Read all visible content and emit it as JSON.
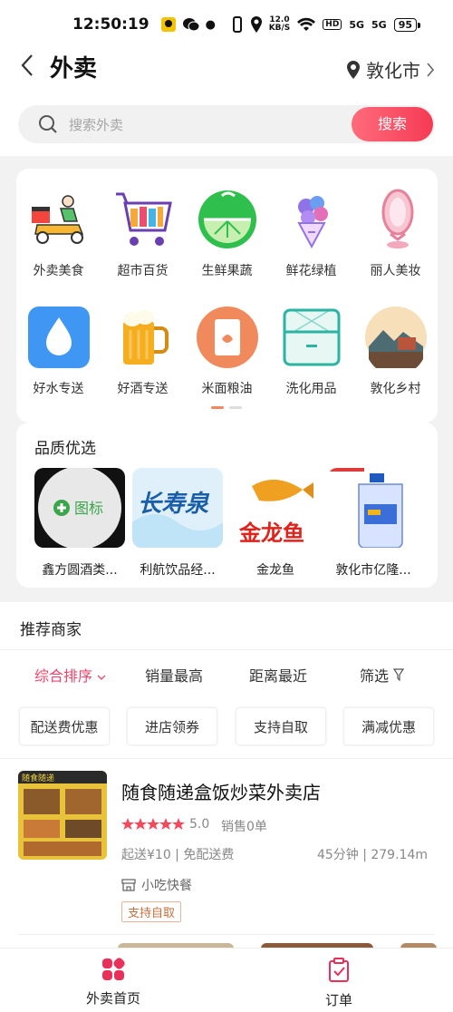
{
  "status_bar": {
    "time": "12:50:19",
    "net_speed": "12.0",
    "net_unit": "KB/S",
    "hd": "HD",
    "sig1": "5G",
    "sig2": "5G",
    "battery": "95"
  },
  "header": {
    "title": "外卖",
    "city": "敦化市"
  },
  "search": {
    "placeholder": "搜索外卖",
    "button": "搜索"
  },
  "categories": [
    {
      "label": "外卖美食",
      "icon": "delivery-scooter-icon"
    },
    {
      "label": "超市百货",
      "icon": "shopping-cart-icon"
    },
    {
      "label": "生鲜果蔬",
      "icon": "lime-icon"
    },
    {
      "label": "鲜花绿植",
      "icon": "flower-bouquet-icon"
    },
    {
      "label": "丽人美妆",
      "icon": "mirror-icon"
    },
    {
      "label": "好水专送",
      "icon": "water-drop-icon"
    },
    {
      "label": "好酒专送",
      "icon": "beer-icon"
    },
    {
      "label": "米面粮油",
      "icon": "rice-bag-icon"
    },
    {
      "label": "洗化用品",
      "icon": "washing-icon"
    },
    {
      "label": "敦化乡村",
      "icon": "village-icon"
    }
  ],
  "quality": {
    "title": "品质优选",
    "items": [
      {
        "name": "鑫方圆酒类...",
        "image_text": "图标"
      },
      {
        "name": "利航饮品经...",
        "image_text": "长寿泉"
      },
      {
        "name": "金龙鱼",
        "image_text": "金龙鱼"
      },
      {
        "name": "敦化市亿隆...",
        "image_text": ""
      }
    ]
  },
  "recommend": {
    "title": "推荐商家",
    "sort": [
      "综合排序",
      "销量最高",
      "距离最近",
      "筛选"
    ],
    "filters": [
      "配送费优惠",
      "进店领券",
      "支持自取",
      "满减优惠"
    ]
  },
  "shop": {
    "name": "随食随递盒饭炒菜外卖店",
    "rating_value": 5.0,
    "score": "5.0",
    "sales": "销售0单",
    "fee": "起送¥10 | 免配送费",
    "distance": "45分钟 | 279.14m",
    "category": "小吃快餐",
    "tag": "支持自取",
    "thumb_text": "随食随递"
  },
  "tabbar": {
    "home": "外卖首页",
    "orders": "订单"
  },
  "colors": {
    "accent": "#f0446b",
    "button": "#f53b54",
    "page_gray": "#f2f2f2"
  }
}
